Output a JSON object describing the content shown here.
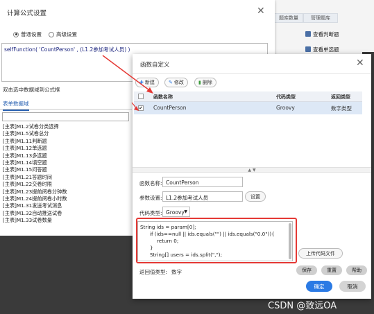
{
  "background_page": {
    "column_headers": [
      "题库数量",
      "管理题库"
    ],
    "row_buttons": [
      "查看判断题",
      "查看单选题"
    ]
  },
  "formula_dialog": {
    "title": "计算公式设置",
    "modes": [
      {
        "label": "普通设置",
        "selected": true
      },
      {
        "label": "高级设置",
        "selected": false
      }
    ],
    "formula": "selfFunction( 'CountPerson' , (L1.2参加考试人员) )",
    "hint": "双击选中数据域到公式框",
    "tab_label": "表单数据域",
    "fields": [
      "[主表]M1.2试卷分类选择",
      "[主表]M1.5试卷总分",
      "[主表]M1.11判断题",
      "[主表]M1.12单选题",
      "[主表]M1.13多选题",
      "[主表]M1.14填空题",
      "[主表]M1.15问答题",
      "[主表]M1.21答题时间",
      "[主表]M1.22交卷时限",
      "[主表]M1.23提前阅卷分钟数",
      "[主表]M1.24提前阅卷小时数",
      "[主表]M1.31发送考试消息",
      "[主表]M1.32自动推送试卷",
      "[主表]M1.33试卷数量"
    ]
  },
  "function_dialog": {
    "title": "函数自定义",
    "toolbar": {
      "new_label": "新建",
      "edit_label": "修改",
      "delete_label": "删除"
    },
    "grid": {
      "columns": [
        "函数名称",
        "代码类型",
        "返回类型"
      ],
      "rows": [
        {
          "checked": true,
          "name": "CountPerson",
          "code_type": "Groovy",
          "return_type": "数字类型"
        }
      ]
    },
    "form": {
      "name_label": "函数名称:",
      "name_value": "CountPerson",
      "param_label": "参数设置:",
      "param_value": "L1.2参加考试人员",
      "param_button": "设置",
      "code_type_label": "代码类型:",
      "code_type_value": "Groovy",
      "code_lines": [
        "String ids = param[0];",
        "if (ids==null || ids.equals(\"\") || ids.equals(\"0.0\")){",
        "return 0;",
        "}",
        "String[] users = ids.split(\",\");"
      ],
      "upload_button": "上传代码文件",
      "return_type_label": "返回值类型:",
      "return_type_value": "数字",
      "save_button": "保存",
      "reset_button": "重置",
      "help_button": "帮助"
    },
    "ok_button": "确定",
    "cancel_button": "取消"
  },
  "colors": {
    "primary": "#2b7ae4",
    "annotation_red": "#e53935",
    "link_blue": "#2b63b3"
  },
  "watermark": "CSDN @致远OA"
}
